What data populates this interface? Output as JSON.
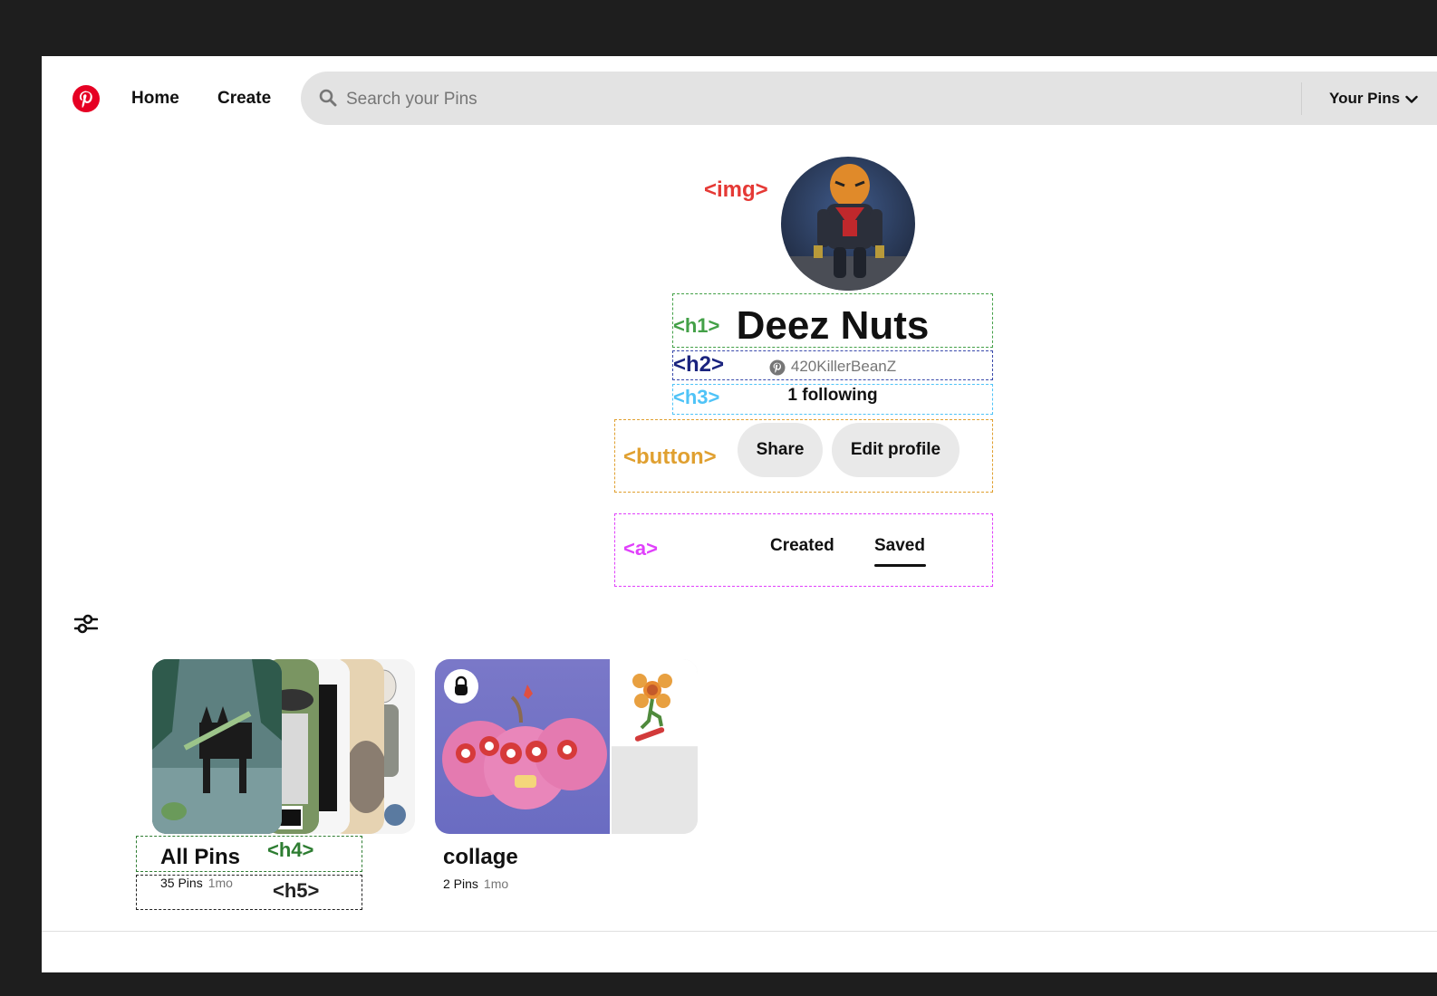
{
  "nav": {
    "home_label": "Home",
    "create_label": "Create",
    "search_placeholder": "Search your Pins",
    "your_pins_label": "Your Pins",
    "brand_color": "#e60023"
  },
  "profile": {
    "name": "Deez Nuts",
    "username": "420KillerBeanZ",
    "following": "1 following",
    "share_label": "Share",
    "edit_label": "Edit profile"
  },
  "tabs": {
    "created": "Created",
    "saved": "Saved",
    "active": "Saved"
  },
  "annotations": {
    "img": "<img>",
    "h1": "<h1>",
    "h2": "<h2>",
    "h3": "<h3>",
    "button": "<button>",
    "a": "<a>",
    "h4": "<h4>",
    "h5": "<h5>",
    "colors": {
      "img": "#e53935",
      "h1": "#43a047",
      "h2": "#1a237e",
      "h3": "#4fc3f7",
      "button": "#e0a030",
      "a": "#e040fb",
      "h4": "#2e7d32",
      "h5": "#222222"
    }
  },
  "boards": [
    {
      "title": "All Pins",
      "count": "35 Pins",
      "age": "1mo"
    },
    {
      "title": "collage",
      "count": "2 Pins",
      "age": "1mo",
      "secret": true
    }
  ],
  "icons": [
    "pinterest-logo-icon",
    "search-icon",
    "chevron-down-icon",
    "filter-sliders-icon",
    "lock-icon"
  ]
}
